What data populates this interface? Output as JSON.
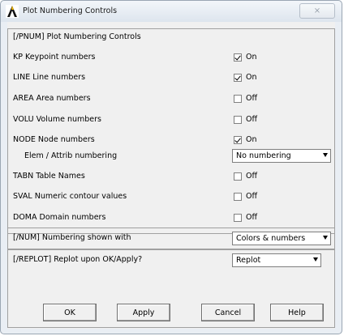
{
  "window": {
    "title": "Plot Numbering Controls",
    "close_glyph": "⨯"
  },
  "header": "[/PNUM]  Plot Numbering Controls",
  "rows": [
    {
      "label": "KP   Keypoint numbers",
      "checked": true,
      "state": "On"
    },
    {
      "label": "LINE  Line numbers",
      "checked": true,
      "state": "On"
    },
    {
      "label": "AREA  Area numbers",
      "checked": false,
      "state": "Off"
    },
    {
      "label": "VOLU  Volume numbers",
      "checked": false,
      "state": "Off"
    },
    {
      "label": "NODE  Node numbers",
      "checked": true,
      "state": "On"
    }
  ],
  "elem_numbering": {
    "label": "Elem / Attrib numbering",
    "selected": "No numbering"
  },
  "rows2": [
    {
      "label": "TABN  Table Names",
      "checked": false,
      "state": "Off"
    },
    {
      "label": "SVAL  Numeric contour values",
      "checked": false,
      "state": "Off"
    },
    {
      "label": "DOMA  Domain numbers",
      "checked": false,
      "state": "Off"
    }
  ],
  "num": {
    "label": "[/NUM]  Numbering shown with",
    "selected": "Colors & numbers"
  },
  "replot": {
    "label": "[/REPLOT] Replot upon OK/Apply?",
    "selected": "Replot"
  },
  "buttons": {
    "ok": "OK",
    "apply": "Apply",
    "cancel": "Cancel",
    "help": "Help"
  },
  "colors": {
    "window_bg": "#e9eef4",
    "client_bg": "#f0f0f0",
    "border": "#a0a0a0"
  },
  "icons": {
    "app": "ansys-logo-icon",
    "close": "close-icon",
    "check": "checkmark-icon",
    "dropdown": "chevron-down-icon"
  }
}
